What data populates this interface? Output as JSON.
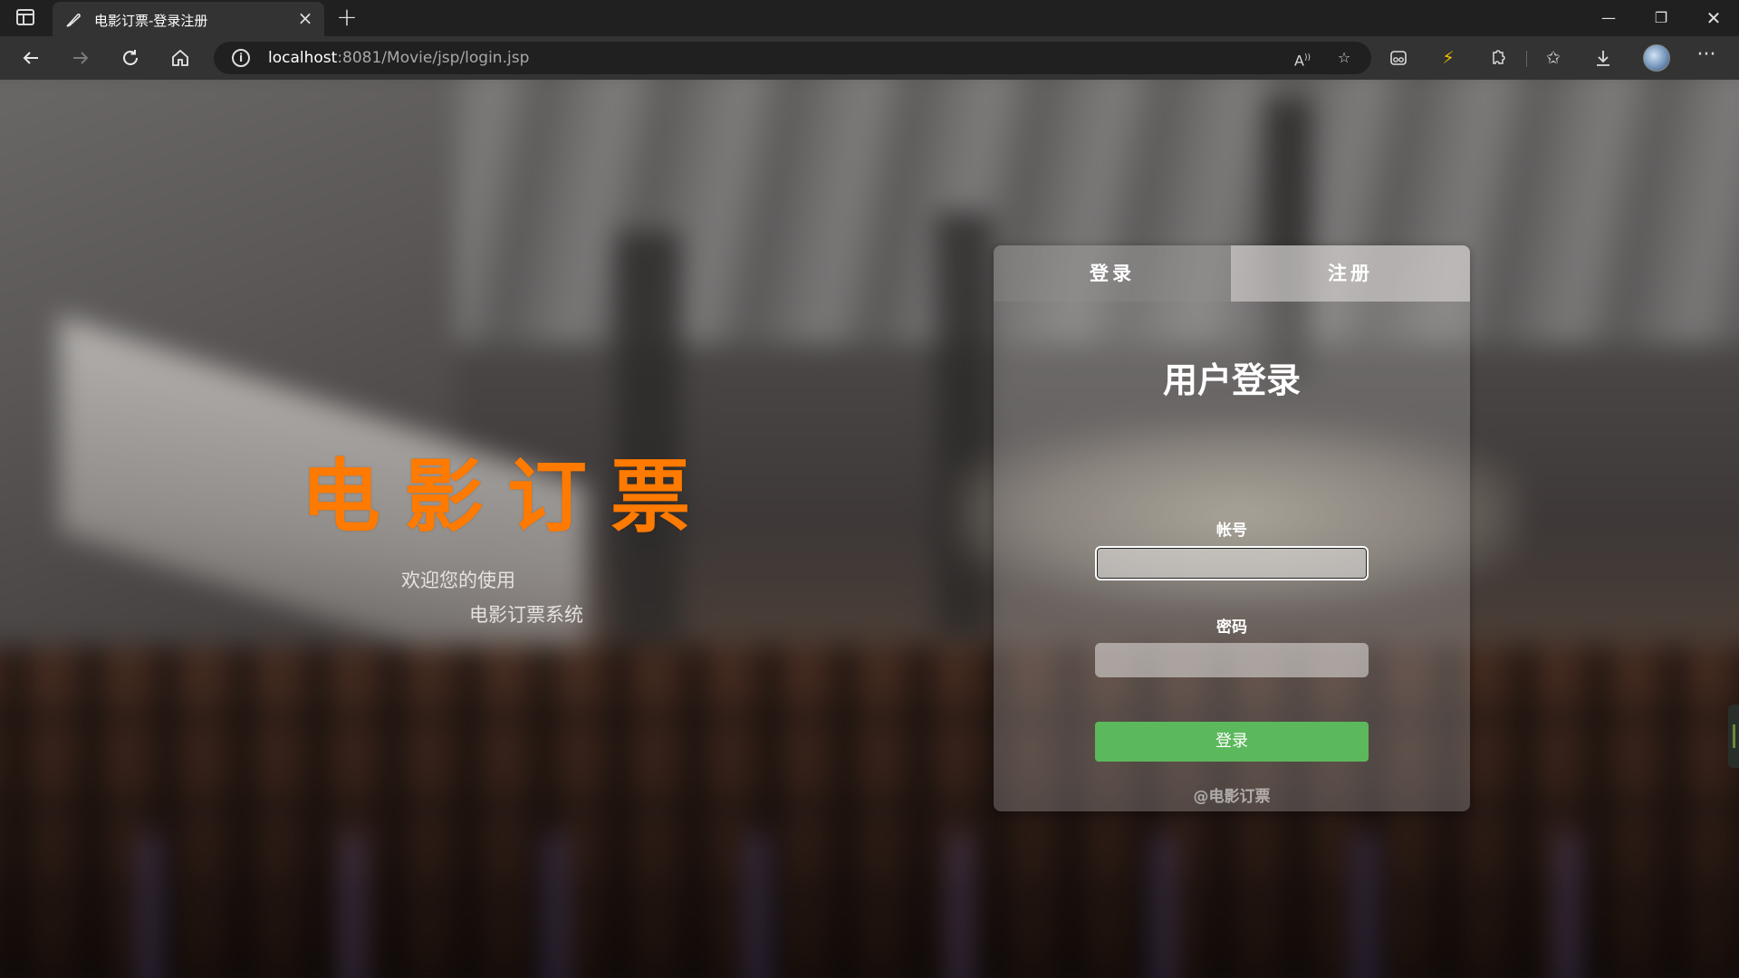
{
  "browser": {
    "tab_title": "电影订票-登录注册",
    "tab_close": "×",
    "new_tab": "+",
    "url_host": "localhost",
    "url_rest": ":8081/Movie/jsp/login.jsp",
    "window_min": "—",
    "window_max": "❐",
    "window_close": "✕",
    "icons": [
      "sidebar-toggle-icon",
      "back-icon",
      "forward-icon",
      "reload-icon",
      "home-icon",
      "site-info-icon",
      "read-aloud-icon",
      "add-favorite-icon",
      "extension-icon",
      "puzzle-icon",
      "favorites-icon",
      "download-icon",
      "profile-avatar",
      "more-icon"
    ]
  },
  "page": {
    "brand": "电影订票",
    "welcome_line1": "欢迎您的使用",
    "welcome_line2": "电影订票系统"
  },
  "login_card": {
    "tab_login": "登录",
    "tab_register": "注册",
    "title": "用户登录",
    "account_label": "帐号",
    "account_value": "",
    "password_label": "密码",
    "password_value": "",
    "submit_label": "登录",
    "footer": "@电影订票"
  },
  "colors": {
    "brand": "#ff7a00",
    "submit_button": "#5cb85c",
    "chrome_dark": "#202020",
    "chrome_toolbar": "#333333"
  }
}
